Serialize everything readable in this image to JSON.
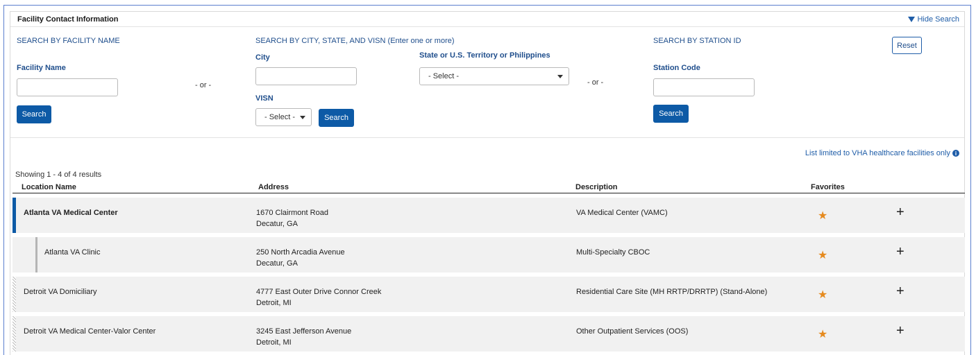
{
  "header": {
    "title": "Facility Contact Information",
    "hide_search": "Hide Search"
  },
  "search": {
    "by_name_title": "SEARCH BY FACILITY NAME",
    "facility_name_label": "Facility Name",
    "facility_name_value": "",
    "search_button": "Search",
    "or_text": "- or -",
    "by_city_title": "SEARCH BY CITY, STATE, AND VISN",
    "by_city_hint": "(Enter one or more)",
    "city_label": "City",
    "city_value": "",
    "state_label": "State or U.S. Territory or Philippines",
    "state_selected": "- Select -",
    "visn_label": "VISN",
    "visn_selected": "- Select -",
    "by_station_title": "SEARCH BY STATION ID",
    "station_label": "Station Code",
    "station_value": "",
    "reset_button": "Reset"
  },
  "results": {
    "limited_note": "List limited to VHA healthcare facilities only",
    "info_icon": "info-icon",
    "showing": "Showing 1 - 4 of 4 results",
    "columns": [
      "Location Name",
      "Address",
      "Description",
      "Favorites"
    ],
    "rows": [
      {
        "name": "Atlanta VA Medical Center",
        "address1": "1670 Clairmont Road",
        "address2": "Decatur, GA",
        "description": "VA Medical Center (VAMC)"
      },
      {
        "name": "Atlanta VA Clinic",
        "address1": "250 North Arcadia Avenue",
        "address2": "Decatur, GA",
        "description": "Multi-Specialty CBOC"
      },
      {
        "name": "Detroit VA Domiciliary",
        "address1": "4777 East Outer Drive Connor Creek",
        "address2": "Detroit, MI",
        "description": "Residential Care Site (MH RRTP/DRRTP) (Stand-Alone)"
      },
      {
        "name": "Detroit VA Medical Center-Valor Center",
        "address1": "3245 East Jefferson Avenue",
        "address2": "Detroit, MI",
        "description": "Other Outpatient Services (OOS)"
      }
    ],
    "favorite_icon": "star-icon",
    "add_icon": "plus-icon"
  },
  "colors": {
    "primary_button": "#0d5aa6",
    "link_blue": "#1f5da8",
    "label_blue": "#1f4e8c",
    "favorite_star": "#e58a1f",
    "row_background": "#f1f1f1"
  }
}
